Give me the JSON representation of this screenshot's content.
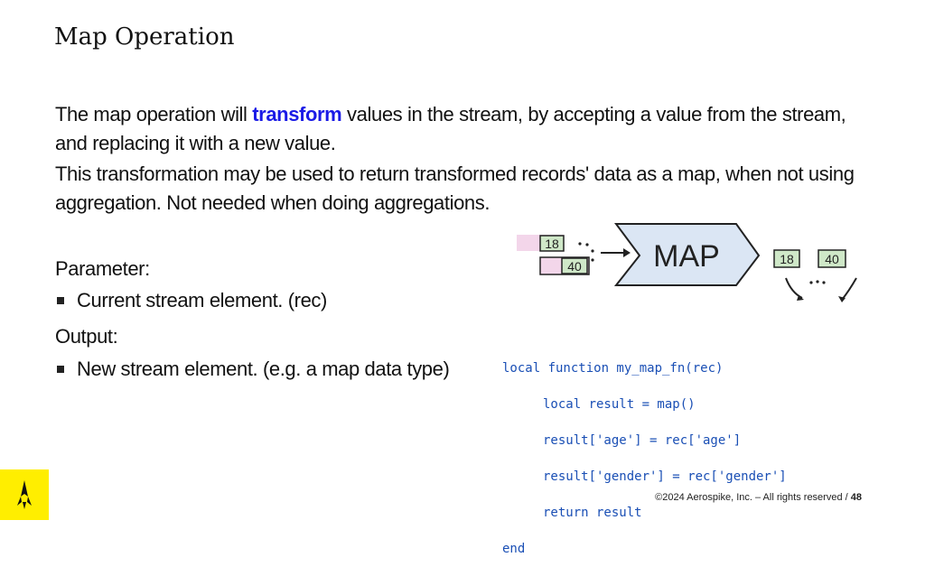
{
  "slide": {
    "title": "Map Operation",
    "para1_before": "The map operation will ",
    "para1_highlight": "transform",
    "para1_after": " values in the stream, by accepting a value from the stream, and replacing it with a new value.",
    "para2": "This transformation may be used to return transformed records' data as a map, when not using aggregation. Not needed when doing aggregations.",
    "parameter_label": "Parameter:",
    "parameter_item": "Current stream element.  (rec)",
    "output_label": "Output:",
    "output_item": "New stream element.  (e.g. a map data type)"
  },
  "diagram": {
    "map_label": "MAP",
    "input_values": [
      "18",
      "40"
    ],
    "output_values": [
      "18",
      "40"
    ],
    "fill_color": "#dbe6f4",
    "box_color": "#cfe8c8"
  },
  "code": {
    "lines": [
      "local function my_map_fn(rec)",
      "local result = map()",
      "result['age'] = rec['age']",
      "result['gender'] = rec['gender']",
      "return result",
      "end"
    ]
  },
  "footer": {
    "copyright": "©2024 Aerospike, Inc. – All rights reserved",
    "page_sep": " / ",
    "page_number": "48"
  },
  "icons": {
    "logo": "aerospike-rocket-icon"
  }
}
